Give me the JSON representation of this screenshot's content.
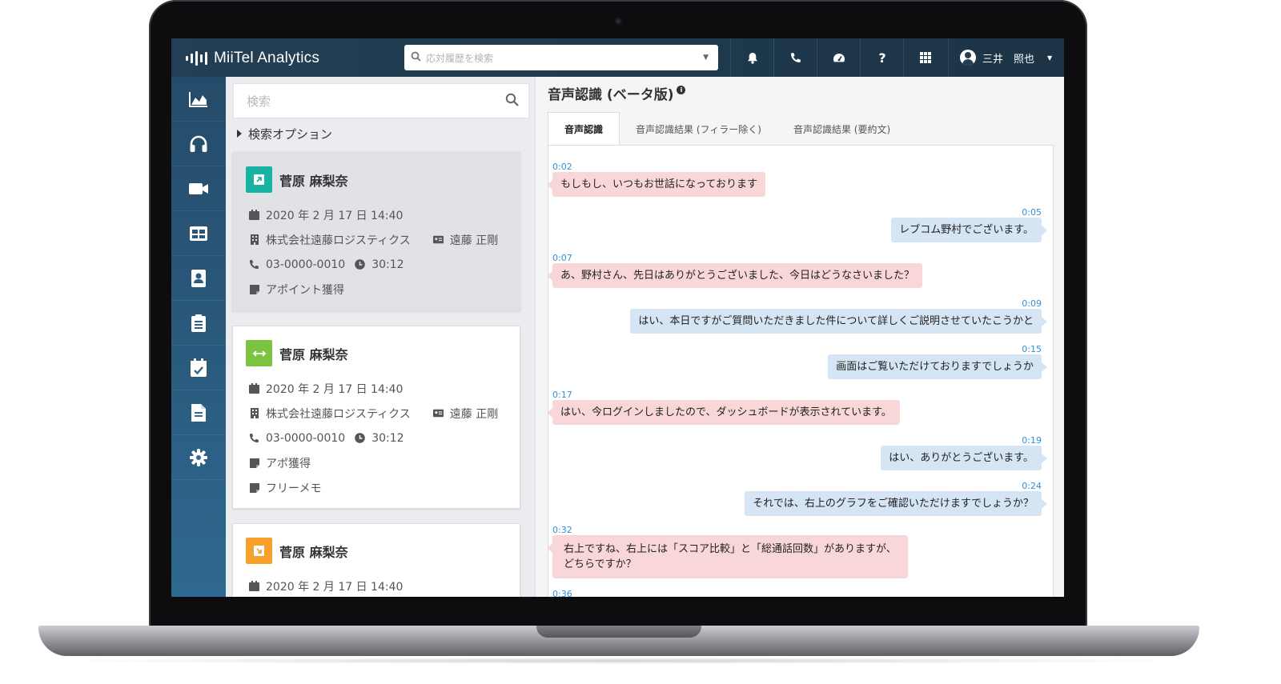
{
  "app": {
    "title": "MiiTel Analytics"
  },
  "header": {
    "search_placeholder": "応対履歴を検索",
    "user_name": "三井　照也",
    "icons": [
      "bell-icon",
      "phone-icon",
      "dashboard-icon",
      "help-icon",
      "apps-grid-icon"
    ],
    "help_label": "?"
  },
  "sidebar": {
    "items": [
      "chart-icon",
      "headphones-icon",
      "video-icon",
      "table-icon",
      "contact-icon",
      "clipboard-icon",
      "calendar-check-icon",
      "document-icon",
      "gear-icon"
    ]
  },
  "list": {
    "search_placeholder": "検索",
    "options_label": "検索オプション",
    "cards": [
      {
        "name": "菅原 麻梨奈",
        "date": "2020 年 2 月 17 日 14:40",
        "company": "株式会社遠藤ロジスティクス",
        "contact": "遠藤 正剛",
        "phone": "03-0000-0010",
        "duration": "30:12",
        "notes": [
          "アポイント獲得"
        ],
        "badge_color": "#19b3a4",
        "badge_icon": "outgoing-call-icon"
      },
      {
        "name": "菅原 麻梨奈",
        "date": "2020 年 2 月 17 日 14:40",
        "company": "株式会社遠藤ロジスティクス",
        "contact": "遠藤 正剛",
        "phone": "03-0000-0010",
        "duration": "30:12",
        "notes": [
          "アポ獲得",
          "フリーメモ"
        ],
        "badge_color": "#7cc342",
        "badge_icon": "transfer-call-icon"
      },
      {
        "name": "菅原 麻梨奈",
        "date": "2020 年 2 月 17 日 14:40",
        "badge_color": "#f7a12a",
        "badge_icon": "incoming-call-icon"
      }
    ]
  },
  "transcript": {
    "title": "音声認識 (ベータ版)",
    "info_glyph": "i",
    "tabs": [
      "音声認識",
      "音声認識結果 (フィラー除く)",
      "音声認識結果 (要約文)"
    ],
    "messages": [
      {
        "side": "left",
        "time": "0:02",
        "text": "もしもし、いつもお世話になっております"
      },
      {
        "side": "right",
        "time": "0:05",
        "text": "レブコム野村でございます。"
      },
      {
        "side": "left",
        "time": "0:07",
        "text": "あ、野村さん、先日はありがとうございました、今日はどうなさいました？"
      },
      {
        "side": "right",
        "time": "0:09",
        "text": "はい、本日ですがご質問いただきました件について詳しくご説明させていたこうかと"
      },
      {
        "side": "right",
        "time": "0:15",
        "text": "画面はご覧いただけておりますでしょうか"
      },
      {
        "side": "left",
        "time": "0:17",
        "text": "はい、今ログインしましたので、ダッシュボードが表示されています。"
      },
      {
        "side": "right",
        "time": "0:19",
        "text": "はい、ありがとうございます。"
      },
      {
        "side": "right",
        "time": "0:24",
        "text": "それでは、右上のグラフをご確認いただけますでしょうか？"
      },
      {
        "side": "left",
        "time": "0:32",
        "text": "右上ですね、右上には「スコア比較」と「総通話回数」がありますが、\nどちらですか？"
      },
      {
        "side": "left",
        "time": "0:36",
        "text": ""
      }
    ]
  }
}
